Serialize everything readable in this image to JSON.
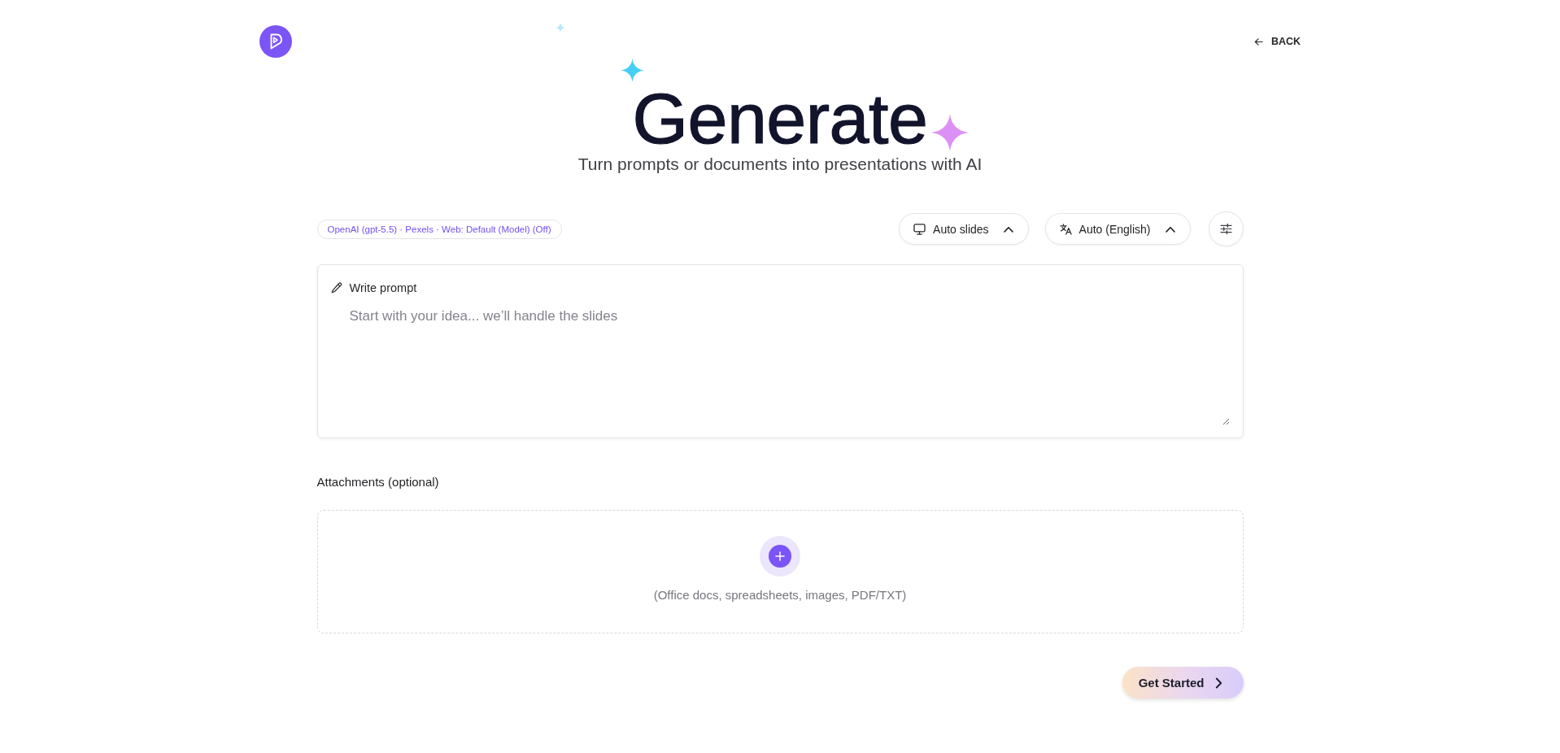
{
  "header": {
    "back_link": "BACK"
  },
  "hero": {
    "title": "Generate",
    "subtitle": "Turn prompts or documents into presentations with AI"
  },
  "toolbar": {
    "model_chip": "OpenAI (gpt-5.5) · Pexels · Web: Default (Model) (Off)",
    "dropdowns": [
      {
        "kind": "slides",
        "label": "Auto slides"
      },
      {
        "kind": "language",
        "label": "Auto (English)"
      }
    ]
  },
  "prompt": {
    "label": "Write prompt",
    "placeholder": "Start with your idea... we’ll handle the slides"
  },
  "attachments": {
    "label": "Attachments (optional)",
    "hint": "(Office docs, spreadsheets, images, PDF/TXT)"
  },
  "actions": {
    "primary_button": "Get Started"
  }
}
